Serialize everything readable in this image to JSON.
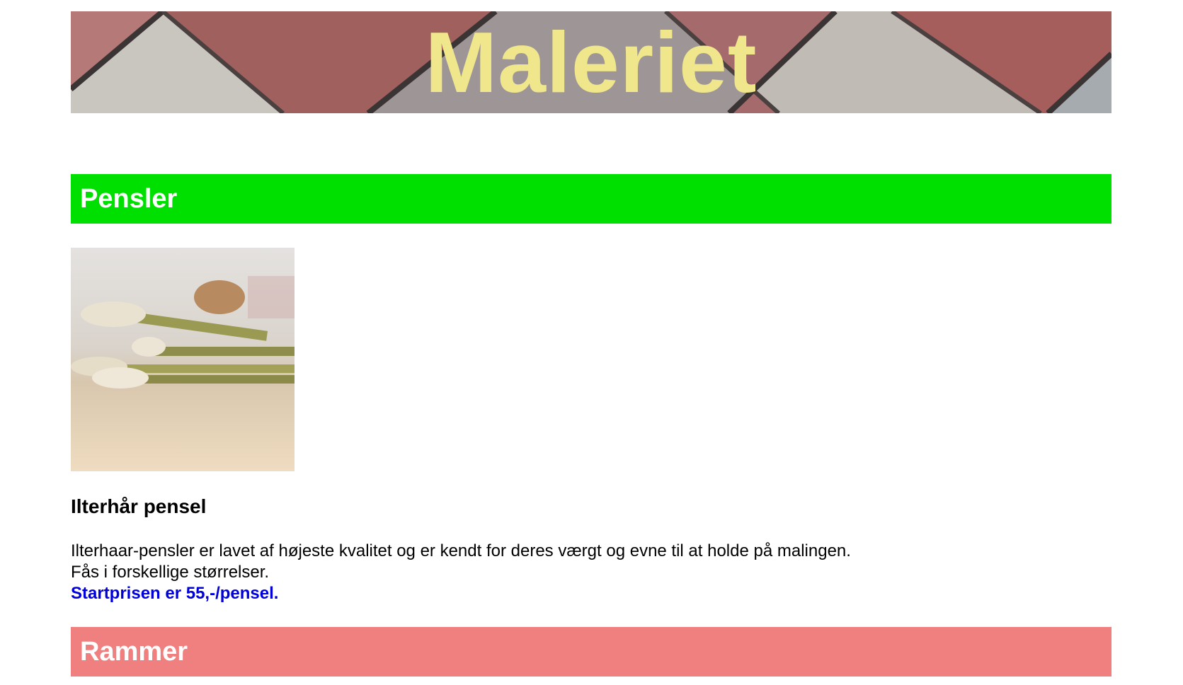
{
  "header": {
    "title": "Maleriet"
  },
  "sections": [
    {
      "heading": "Pensler",
      "color": "#00e000",
      "product": {
        "image": "paint-brushes-image",
        "title": "Ilterhår pensel",
        "description_line1": "Ilterhaar-pensler er lavet af højeste kvalitet og er kendt for deres værgt og evne til at holde på malingen.",
        "description_line2": "Fås i forskellige størrelser.",
        "price_text": "Startprisen er 55,-/pensel."
      }
    },
    {
      "heading": "Rammer",
      "color": "#f08080"
    }
  ],
  "colors": {
    "title_text": "#f0e68c",
    "price_text": "#0000dd"
  }
}
